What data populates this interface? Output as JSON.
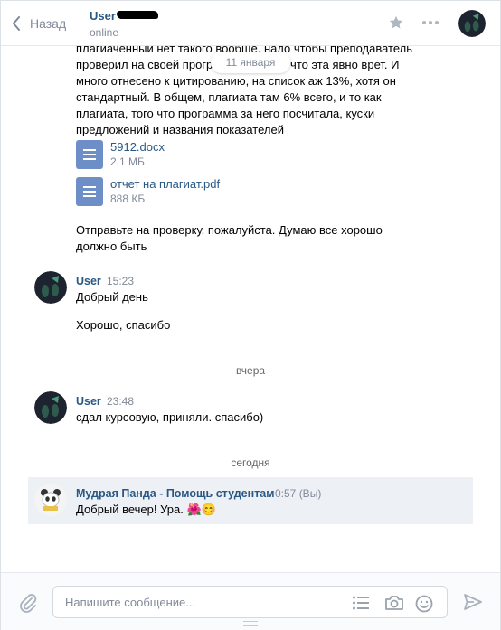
{
  "header": {
    "back_label": "Назад",
    "peer_name": "User",
    "peer_status": "online",
    "date_pill": "11 января"
  },
  "history": {
    "first_message_lines": [
      "плагиаченный нет такого вообще. надо чтобы преподаватель",
      "проверил на своей программе, потому что эта явно врет. И",
      "много отнесено к цитированию, на список аж 13%, хотя он",
      "стандартный. В общем, плагиата там 6% всего, и то как",
      "плагиата, того что программа за него посчитала, куски",
      "предложений и названия показателей"
    ],
    "documents": [
      {
        "name": "5912.docx",
        "size": "2.1 МБ"
      },
      {
        "name": "отчет на плагиат.pdf",
        "size": "888 КБ"
      }
    ],
    "followup_lines": [
      "Отправьте на проверку, пожалуйста. Думаю все хорошо",
      "должно быть"
    ],
    "group1": {
      "author": "User",
      "time": "15:23",
      "messages": [
        "Добрый день",
        "Хорошо, спасибо"
      ]
    },
    "separator_yesterday": "вчера",
    "group2": {
      "author": "User",
      "time": "23:48",
      "messages": [
        "сдал курсовую, приняли. спасибо)"
      ]
    },
    "separator_today": "сегодня",
    "group3": {
      "author": "Мудрая Панда - Помощь студентам",
      "time": "0:57 (Вы)",
      "message": "Добрый вечер! Ура. 🌺😊"
    }
  },
  "composer": {
    "placeholder": "Напишите сообщение..."
  },
  "colors": {
    "link": "#2a5885",
    "muted": "#828a99",
    "highlight": "#edf0f5",
    "doc_icon": "#6d8ec6"
  }
}
